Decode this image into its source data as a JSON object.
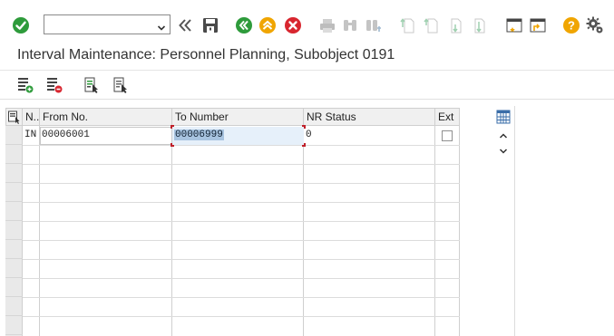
{
  "toolbar": {
    "command_field_value": "",
    "icons": [
      "enter-icon",
      "back-nav-icon",
      "save-icon",
      "back-icon",
      "exit-icon",
      "cancel-icon",
      "print-icon",
      "find-icon",
      "find-next-icon",
      "first-page-icon",
      "previous-page-icon",
      "next-page-icon",
      "last-page-icon",
      "create-session-icon",
      "generate-shortcut-icon",
      "help-icon",
      "settings-icon"
    ]
  },
  "title": "Interval Maintenance: Personnel Planning, Subobject 0191",
  "app_toolbar": {
    "icons": [
      "insert-interval-icon",
      "delete-interval-icon",
      "change-status-icon",
      "overview-icon"
    ]
  },
  "table": {
    "columns": [
      "N..",
      "From No.",
      "To Number",
      "NR Status",
      "Ext"
    ],
    "rows": [
      {
        "no": "IN",
        "from": "00006001",
        "to": "00006999",
        "status": "0",
        "ext": false
      }
    ]
  },
  "colors": {
    "enter_green": "#2e9b3b",
    "back_green": "#2e9b3b",
    "exit_orange": "#f0a500",
    "cancel_red": "#d8262f",
    "help_orange": "#f0a500",
    "header_bg": "#f0f0f0",
    "focus_bg": "#e6f0fa"
  }
}
